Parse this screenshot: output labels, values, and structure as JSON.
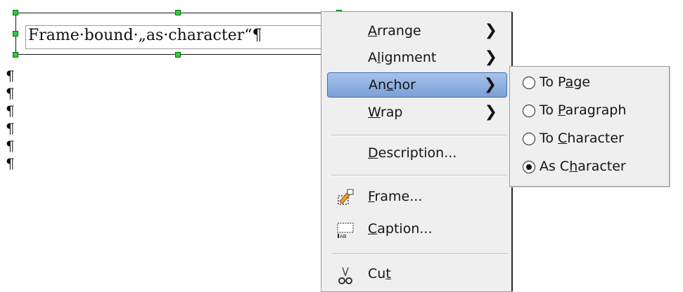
{
  "document": {
    "frame_text": "Frame·bound·„as·character“¶",
    "paragraph_marks": [
      "¶",
      "¶",
      "¶",
      "¶",
      "¶",
      "¶"
    ]
  },
  "context_menu": {
    "items": [
      {
        "prefix": "",
        "mnemonic": "A",
        "suffix": "rrange",
        "has_submenu": true
      },
      {
        "prefix": "A",
        "mnemonic": "l",
        "suffix": "ignment",
        "has_submenu": true
      },
      {
        "prefix": "An",
        "mnemonic": "c",
        "suffix": "hor",
        "has_submenu": true
      },
      {
        "prefix": "",
        "mnemonic": "W",
        "suffix": "rap",
        "has_submenu": true
      },
      {
        "prefix": "",
        "mnemonic": "D",
        "suffix": "escription...",
        "has_submenu": false
      },
      {
        "prefix": "",
        "mnemonic": "F",
        "suffix": "rame...",
        "has_submenu": false
      },
      {
        "prefix": "",
        "mnemonic": "C",
        "suffix": "aption...",
        "has_submenu": false
      },
      {
        "prefix": "Cu",
        "mnemonic": "t",
        "suffix": "",
        "has_submenu": false
      }
    ],
    "chevron": "❯"
  },
  "anchor_submenu": {
    "items": [
      {
        "prefix": "To P",
        "mnemonic": "a",
        "suffix": "ge",
        "checked": false
      },
      {
        "prefix": "To ",
        "mnemonic": "P",
        "suffix": "aragraph",
        "checked": false
      },
      {
        "prefix": "To ",
        "mnemonic": "C",
        "suffix": "haracter",
        "checked": false
      },
      {
        "prefix": "As C",
        "mnemonic": "h",
        "suffix": "aracter",
        "checked": true
      }
    ]
  },
  "colors": {
    "highlight_top": "#a8c3ea",
    "highlight_bottom": "#7aa0d6",
    "handle": "#2ecc40"
  }
}
